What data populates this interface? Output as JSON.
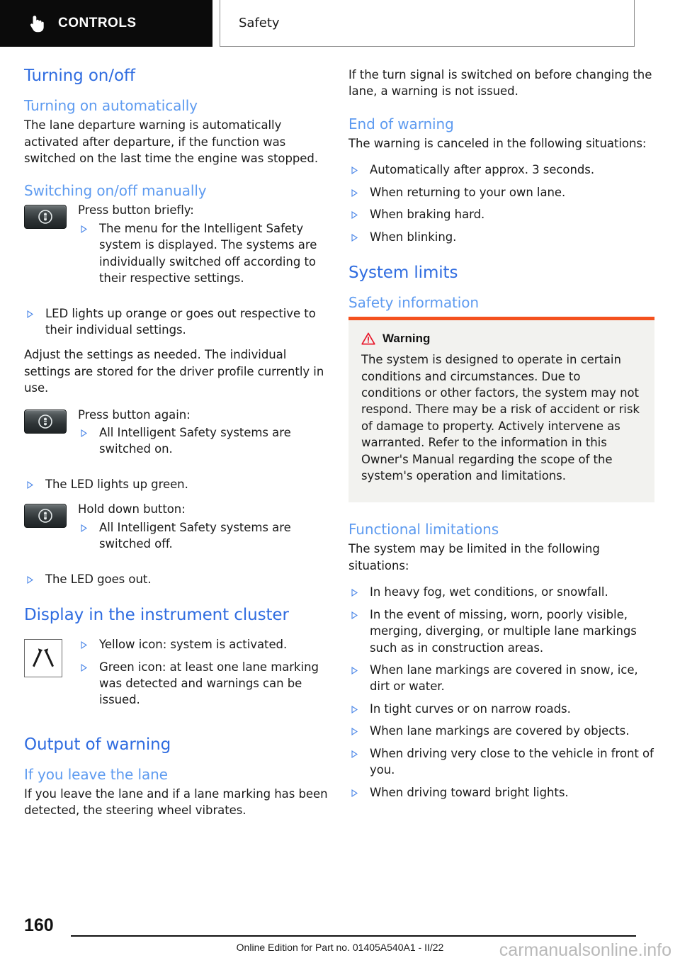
{
  "header": {
    "chapter_label": "CONTROLS",
    "chapter_icon": "hand-pointer-icon",
    "section_label": "Safety"
  },
  "left_column": {
    "h1_turning": "Turning on/off",
    "h2_auto": "Turning on automatically",
    "p_auto": "The lane departure warning is automatically activated after departure, if the function was switched on the last time the engine was stopped.",
    "h2_manual": "Switching on/off manually",
    "press_brief": {
      "icon": "intelligent-safety-button-icon",
      "label": "Press button briefly:",
      "bullets": [
        "The menu for the Intelligent Safety system is displayed. The systems are individually switched off according to their respective settings."
      ]
    },
    "led_orange_bullet": "LED lights up orange or goes out respective to their individual settings.",
    "p_adjust": "Adjust the settings as needed. The individual settings are stored for the driver profile currently in use.",
    "press_again": {
      "icon": "intelligent-safety-button-icon",
      "label": "Press button again:",
      "bullets": [
        "All Intelligent Safety systems are switched on."
      ]
    },
    "led_green_bullet": "The LED lights up green.",
    "hold_down": {
      "icon": "intelligent-safety-button-icon",
      "label": "Hold down button:",
      "bullets": [
        "All Intelligent Safety systems are switched off."
      ]
    },
    "led_out_bullet": "The LED goes out.",
    "h1_display": "Display in the instrument cluster",
    "display_icon": "lane-departure-warning-icon",
    "display_bullets": [
      "Yellow icon: system is activated.",
      "Green icon: at least one lane marking was detected and warnings can be issued."
    ],
    "h1_output": "Output of warning",
    "h2_leave_lane": "If you leave the lane",
    "p_leave_lane": "If you leave the lane and if a lane marking has been detected, the steering wheel vibrates."
  },
  "right_column": {
    "p_turn_signal": "If the turn signal is switched on before changing the lane, a warning is not issued.",
    "h2_end_warning": "End of warning",
    "p_canceled": "The warning is canceled in the following situations:",
    "end_bullets": [
      "Automatically after approx. 3 seconds.",
      "When returning to your own lane.",
      "When braking hard.",
      "When blinking."
    ],
    "h1_system_limits": "System limits",
    "h2_safety_info": "Safety information",
    "warning": {
      "icon": "warning-triangle-icon",
      "title": "Warning",
      "text": "The system is designed to operate in certain conditions and circumstances. Due to conditions or other factors, the system may not respond. There may be a risk of accident or risk of damage to property. Actively intervene as warranted. Refer to the information in this Owner's Manual regarding the scope of the system's operation and limitations."
    },
    "h2_functional_limits": "Functional limitations",
    "p_may_be_limited": "The system may be limited in the following situations:",
    "limit_bullets": [
      "In heavy fog, wet conditions, or snowfall.",
      "In the event of missing, worn, poorly visible, merging, diverging, or multiple lane markings such as in construction areas.",
      "When lane markings are covered in snow, ice, dirt or water.",
      "In tight curves or on narrow roads.",
      "When lane markings are covered by objects.",
      "When driving very close to the vehicle in front of you.",
      "When driving toward bright lights."
    ]
  },
  "footer": {
    "page_number": "160",
    "edition": "Online Edition for Part no. 01405A540A1 - II/22",
    "watermark": "carmanualsonline.info"
  },
  "colors": {
    "h1_blue": "#2f6ce0",
    "h2_blue": "#5e9bf0",
    "bullet_blue": "#4a86e8",
    "warning_orange": "#f4511e",
    "warning_red": "#e8192c",
    "header_black": "#0b0b0b"
  }
}
